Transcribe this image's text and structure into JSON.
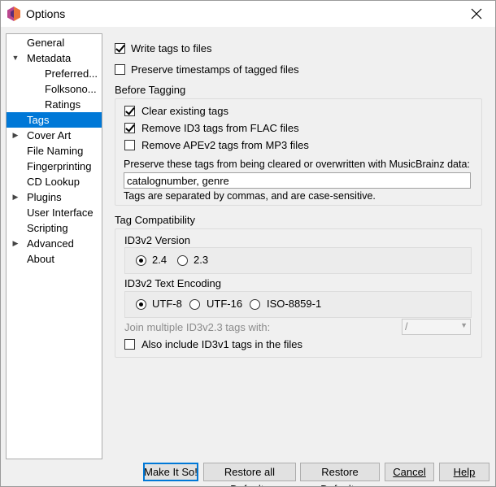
{
  "window": {
    "title": "Options",
    "close_icon": "close-icon"
  },
  "colors": {
    "selection": "#0078d7",
    "background": "#f0f0f0"
  },
  "sidebar": {
    "items": [
      {
        "label": "General",
        "expandable": false,
        "expanded": false
      },
      {
        "label": "Metadata",
        "expandable": true,
        "expanded": true
      },
      {
        "label": "Preferred..."
      },
      {
        "label": "Folksono..."
      },
      {
        "label": "Ratings"
      },
      {
        "label": "Tags",
        "selected": true
      },
      {
        "label": "Cover Art",
        "expandable": true
      },
      {
        "label": "File Naming"
      },
      {
        "label": "Fingerprinting"
      },
      {
        "label": "CD Lookup"
      },
      {
        "label": "Plugins",
        "expandable": true
      },
      {
        "label": "User Interface"
      },
      {
        "label": "Scripting"
      },
      {
        "label": "Advanced",
        "expandable": true
      },
      {
        "label": "About"
      }
    ]
  },
  "tags": {
    "write_tags": {
      "label": "Write tags to files",
      "checked": true
    },
    "preserve_timestamps": {
      "label": "Preserve timestamps of tagged files",
      "checked": false
    },
    "before_tagging": {
      "title": "Before Tagging",
      "clear_existing": {
        "label": "Clear existing tags",
        "checked": true
      },
      "remove_id3_flac": {
        "label": "Remove ID3 tags from FLAC files",
        "checked": true
      },
      "remove_apev2_mp3": {
        "label": "Remove APEv2 tags from MP3 files",
        "checked": false
      },
      "preserve_label": "Preserve these tags from being cleared or overwritten with MusicBrainz data:",
      "preserve_value": "catalognumber, genre",
      "hint": "Tags are separated by commas, and are case-sensitive."
    },
    "compatibility": {
      "title": "Tag Compatibility",
      "id3v2_version_label": "ID3v2 Version",
      "versions": [
        {
          "label": "2.4",
          "checked": true
        },
        {
          "label": "2.3",
          "checked": false
        }
      ],
      "encoding_label": "ID3v2 Text Encoding",
      "encodings": [
        {
          "label": "UTF-8",
          "checked": true
        },
        {
          "label": "UTF-16",
          "checked": false
        },
        {
          "label": "ISO-8859-1",
          "checked": false
        }
      ],
      "join_label": "Join multiple ID3v2.3 tags with:",
      "join_value": "/",
      "id3v1": {
        "label": "Also include ID3v1 tags in the files",
        "checked": false
      }
    }
  },
  "buttons": {
    "make_it_so": "Make It So!",
    "restore_all": "Restore all Defaults",
    "restore": "Restore Defaults",
    "cancel": "Cancel",
    "help": "Help"
  }
}
